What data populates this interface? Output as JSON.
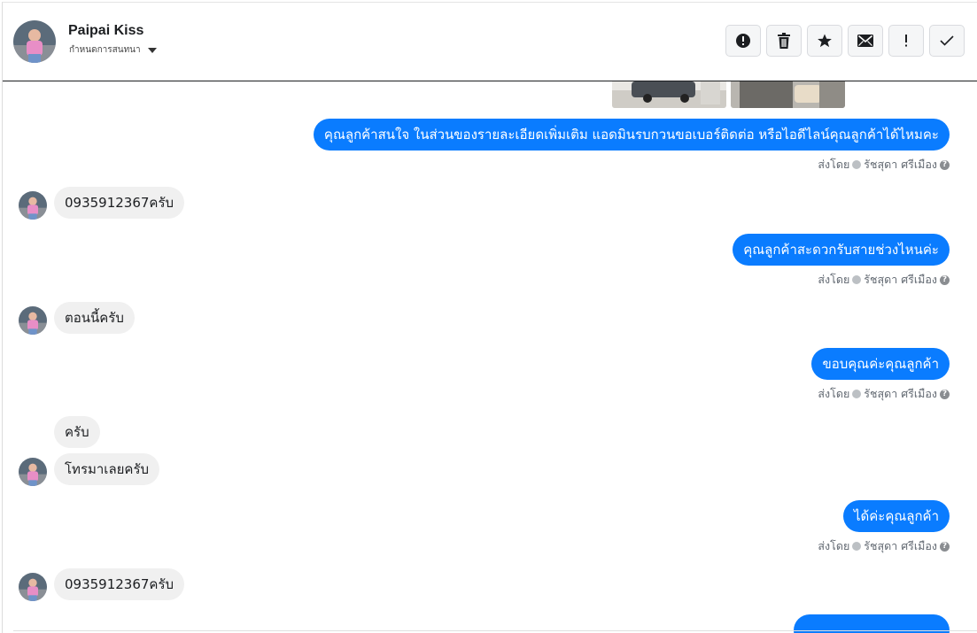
{
  "contact": {
    "name": "Paipai Kiss",
    "assign_label": "กำหนดการสนทนา"
  },
  "toolbar": {
    "buttons": [
      "report-icon",
      "trash-icon",
      "star-icon",
      "mail-icon",
      "exclamation-icon",
      "check-icon"
    ]
  },
  "messages": [
    {
      "dir": "out",
      "text": "คุณลูกค้าสนใจ ในส่วนของรายละเอียดเพิ่มเติม แอดมินรบกวนขอเบอร์ติดต่อ หรือไอดีไลน์คุณลูกค้าได้ไหมคะ",
      "sent_by": "ส่งโดย",
      "sender": "รัชสุดา ศรีเมือง"
    },
    {
      "dir": "in",
      "text": "0935912367ครับ"
    },
    {
      "dir": "out",
      "text": "คุณลูกค้าสะดวกรับสายช่วงไหนค่ะ",
      "sent_by": "ส่งโดย",
      "sender": "รัชสุดา ศรีเมือง"
    },
    {
      "dir": "in",
      "text": "ตอนนี้ครับ"
    },
    {
      "dir": "out",
      "text": "ขอบคุณค่ะคุณลูกค้า",
      "sent_by": "ส่งโดย",
      "sender": "รัชสุดา ศรีเมือง"
    },
    {
      "dir": "in",
      "text": "ครับ"
    },
    {
      "dir": "in",
      "text": "โทรมาเลยครับ"
    },
    {
      "dir": "out",
      "text": "ได้ค่ะคุณลูกค้า",
      "sent_by": "ส่งโดย",
      "sender": "รัชสุดา ศรีเมือง"
    },
    {
      "dir": "in",
      "text": "0935912367ครับ"
    }
  ],
  "colors": {
    "outgoing_bubble": "#0a7cff",
    "incoming_bubble": "#f0f0f0"
  }
}
